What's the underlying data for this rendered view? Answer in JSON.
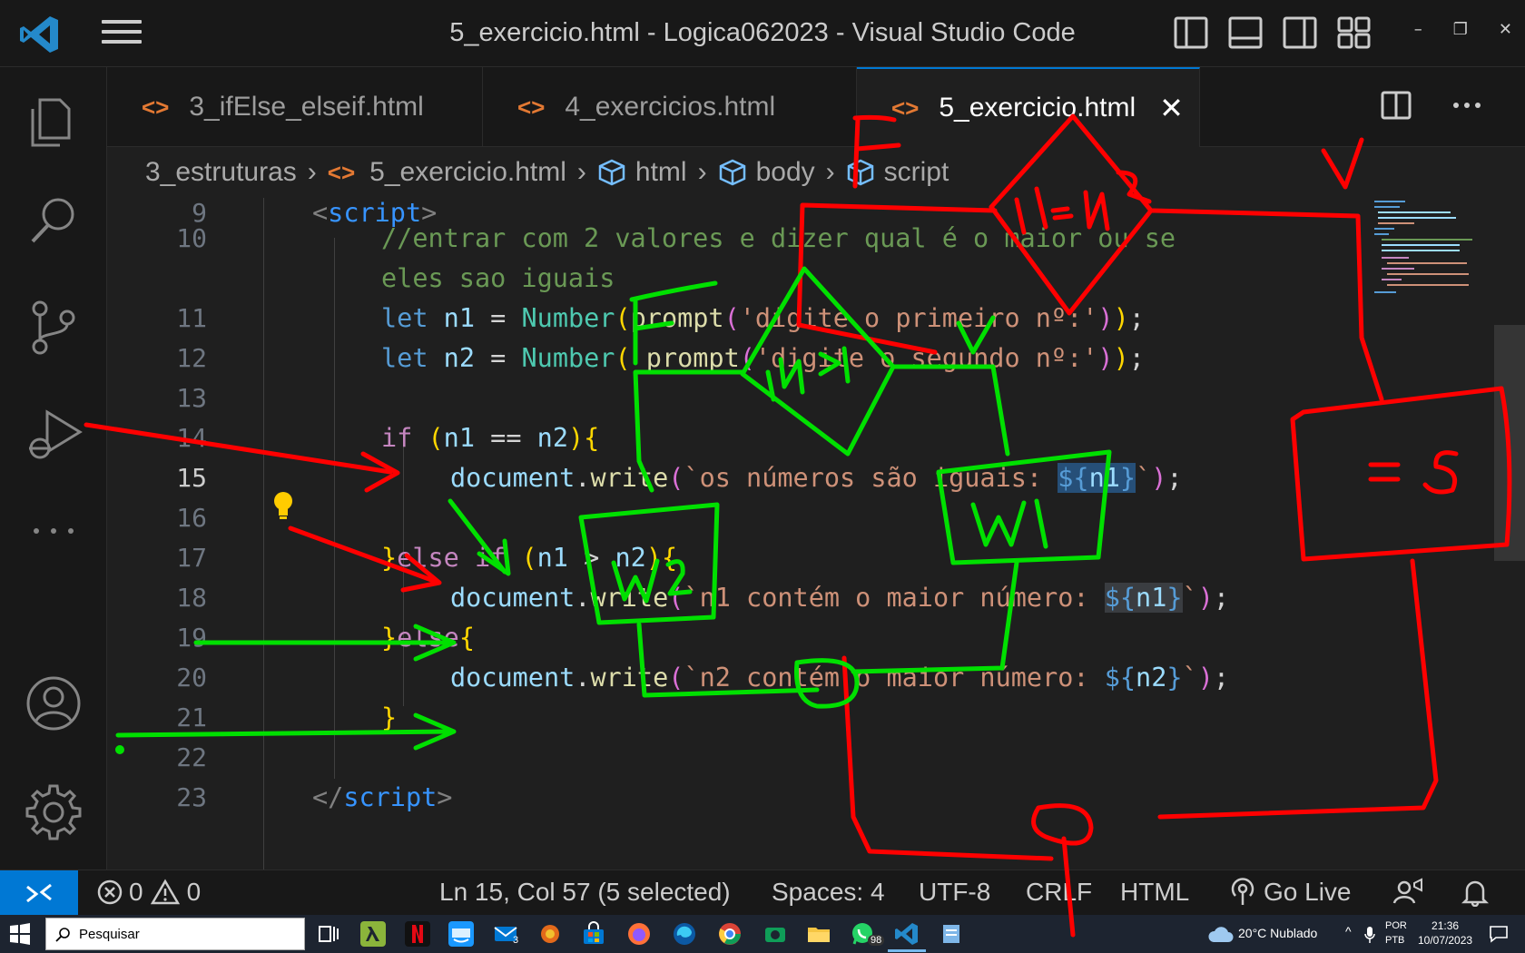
{
  "window": {
    "title": "5_exercicio.html - Logica062023 - Visual Studio Code",
    "controls": [
      "–",
      "❐",
      "✕"
    ]
  },
  "tabs": [
    {
      "label": "3_ifElse_elseif.html",
      "icon": "html-file-icon"
    },
    {
      "label": "4_exercicios.html",
      "icon": "html-file-icon"
    },
    {
      "label": "5_exercicio.html",
      "icon": "html-file-icon",
      "active": true
    }
  ],
  "tab_glyphs": {
    "html": "<>",
    "close": "✕"
  },
  "breadcrumb": {
    "items": [
      "3_estruturas",
      "5_exercicio.html",
      "html",
      "body",
      "script"
    ],
    "separator": "›"
  },
  "editor": {
    "line_numbers": [
      "9",
      "10",
      "",
      "11",
      "12",
      "13",
      "14",
      "15",
      "16",
      "17",
      "18",
      "19",
      "20",
      "21",
      "22",
      "23"
    ],
    "current_line": "15"
  },
  "status": {
    "errors": "0",
    "warnings": "0",
    "position": "Ln 15, Col 57 (5 selected)",
    "spaces": "Spaces: 4",
    "encoding": "UTF-8",
    "eol": "CRLF",
    "language": "HTML",
    "golive": "Go Live"
  },
  "taskbar": {
    "search_placeholder": "Pesquisar",
    "weather": "20°C  Nublado",
    "lang_top": "POR",
    "lang_bottom": "PTB",
    "time": "21:36",
    "date": "10/07/2023",
    "badges": {
      "mail": "3",
      "whatsapp": "98"
    }
  },
  "colors": {
    "accent": "#0078d4",
    "ink_red": "#ff0000",
    "ink_green": "#00e000"
  }
}
